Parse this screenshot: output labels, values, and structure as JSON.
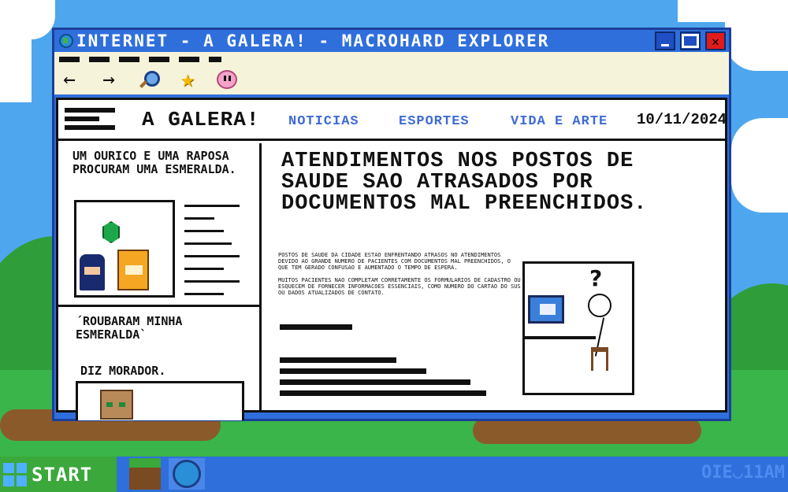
{
  "window": {
    "title": "INTERNET - A GALERA! - MACROHARD EXPLORER"
  },
  "toolbar": {
    "icons": [
      "back-arrow-icon",
      "forward-arrow-icon",
      "search-icon",
      "star-icon",
      "kirby-icon"
    ],
    "back_glyph": "←",
    "forward_glyph": "→",
    "star_glyph": "★"
  },
  "site": {
    "title": "A GALERA!",
    "nav": [
      "NOTICIAS",
      "ESPORTES",
      "VIDA E ARTE"
    ],
    "date": "10/11/2024"
  },
  "sidebar": {
    "story1_title": "UM OURICO E UMA RAPOSA PROCURAM UMA ESMERALDA.",
    "story2_quote": "´ROUBARAM MINHA ESMERALDA`",
    "story2_byline": "DIZ MORADOR."
  },
  "article": {
    "headline": "ATENDIMENTOS NOS POSTOS DE SAUDE SAO ATRASADOS POR DOCUMENTOS MAL PREENCHIDOS.",
    "paragraphs": [
      "POSTOS DE SAUDE DA CIDADE ESTAO ENFRENTANDO ATRASOS NO ATENDIMENTOS DEVIDO AO GRANDE NUMERO DE PACIENTES COM DOCUMENTOS MAL PREENCHIDOS, O QUE TEM GERADO CONFUSAO E AUMENTADO O TEMPO DE ESPERA.",
      "MUITOS PACIENTES NAO COMPLETAM CORRETAMENTE OS FORMULARIOS DE CADASTRO OU ESQUECEM DE FORNECER INFORMACOES ESSENCIAIS, COMO NUMERO DO CARTAO DO SUS OU DADOS ATUALIZADOS DE CONTATO."
    ],
    "illustration_glyph": "?"
  },
  "taskbar": {
    "start_label": "START",
    "clock": "OIE◡11AM"
  }
}
